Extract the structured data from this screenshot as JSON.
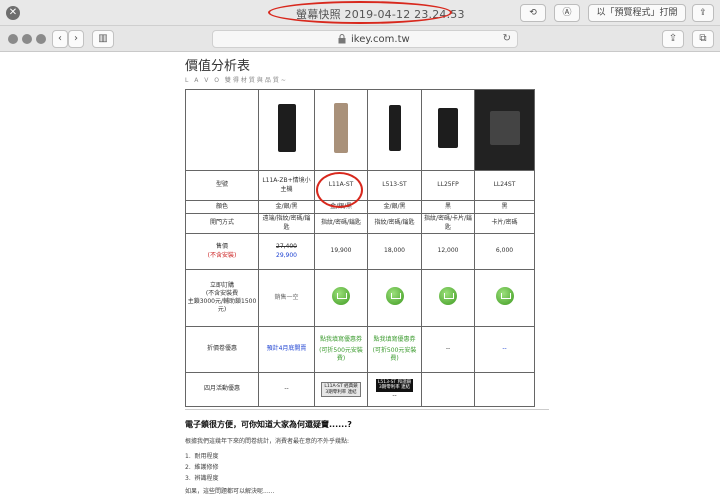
{
  "window": {
    "title": "螢幕快照 2019-04-12 23.24.53",
    "open_with": "以「預覽程式」打開"
  },
  "browser": {
    "url": "ikey.com.tw"
  },
  "page": {
    "title": "價值分析表",
    "subtitle": "L A V O 雙得材質與品質~",
    "table": {
      "headers": {
        "model": "型號",
        "color": "顏色",
        "open_method": "開門方式",
        "price": "售價",
        "price_note": "(不含安裝)",
        "order": "立即訂購",
        "order_note1": "(不含安裝費",
        "order_note2": "主鎖3000元/輔助鎖1500元)",
        "discount": "折價卷優惠",
        "april": "四月活動優惠"
      },
      "products": [
        {
          "model": "L11A-ZB+情境小主機",
          "color": "金/銀/黑",
          "open_method": "遠端/指紋/密碼/鑰匙",
          "price_old": "27,400",
          "price_new": "29,900",
          "order": "銷售一空",
          "discount": "預計4月底開賣",
          "april": "--"
        },
        {
          "model": "L11A-ST",
          "color": "金/銀/黑",
          "open_method": "指紋/密碼/鑰匙",
          "price": "19,900",
          "discount": "點我填寫優惠券",
          "discount_note": "(可折500元安裝費)",
          "april": "L11A-ST 經典鎖\n3期零利率 連結"
        },
        {
          "model": "L513-ST",
          "color": "金/銀/黑",
          "open_method": "指紋/密碼/鑰匙",
          "price": "18,000",
          "discount": "點我填寫優惠券",
          "discount_note": "(可折500元安裝費)",
          "april": "L513-ST 和諧鎖\n3期零利率 連結",
          "april_extra": "--"
        },
        {
          "model": "LL25FP",
          "color": "黑",
          "open_method": "指紋/密碼/卡片/鑰匙",
          "price": "12,000",
          "discount": "--"
        },
        {
          "model": "LL24ST",
          "color": "黑",
          "open_method": "卡片/密碼",
          "price": "6,000",
          "discount": "--"
        }
      ]
    },
    "section_title": "電子鎖很方便，可你知道大家為何還疑竇......?",
    "section_intro": "根據我們這幾年下來的問卷統計，消費者最在意的不外乎幾點:",
    "points": [
      "耐用程度",
      "維護修修",
      "辨識程度"
    ],
    "closing": "如果，這些問題都可以解決呢......"
  },
  "colors": {
    "annotation": "#d8281d",
    "link_blue": "#1a3fd1",
    "link_green": "#3b9b2e"
  }
}
